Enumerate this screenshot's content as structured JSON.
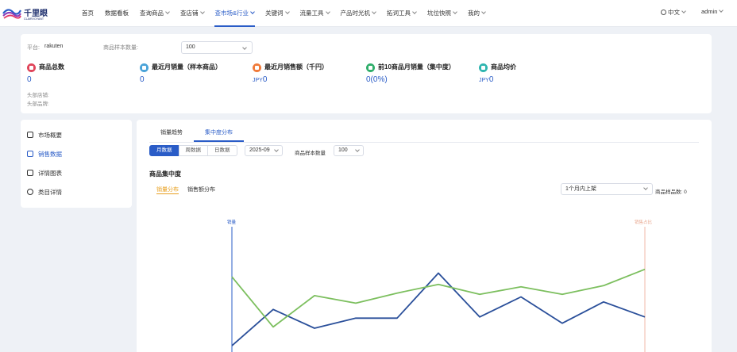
{
  "brand": {
    "name": "千里眼",
    "sub": "CLAIRVOYANT",
    "colors": {
      "primary": "#2a5cc7",
      "accent": "#e8a020"
    }
  },
  "nav": {
    "items": [
      {
        "label": "首页"
      },
      {
        "label": "数据看板"
      },
      {
        "label": "查询商品",
        "dropdown": true
      },
      {
        "label": "查店铺",
        "dropdown": true
      },
      {
        "label": "查市场&行业",
        "dropdown": true,
        "active": true
      },
      {
        "label": "关键词",
        "dropdown": true
      },
      {
        "label": "流量工具",
        "dropdown": true
      },
      {
        "label": "产品时光机",
        "dropdown": true
      },
      {
        "label": "拓词工具",
        "dropdown": true
      },
      {
        "label": "坑位快照",
        "dropdown": true
      },
      {
        "label": "我的",
        "dropdown": true
      }
    ],
    "language": "中文",
    "user": "admin"
  },
  "summary": {
    "platform_label": "平台:",
    "platform_value": "rakuten",
    "sample_label": "商品样本数量:",
    "sample_value": "100",
    "stats": [
      {
        "title": "商品总数",
        "value": "0",
        "currency": "",
        "icon": "box-icon",
        "color": "#e0455a"
      },
      {
        "title": "最近月销量（样本商品）",
        "value": "0",
        "currency": "",
        "icon": "cart-icon",
        "color": "#4aa3d8"
      },
      {
        "title": "最近月销售额（千円）",
        "value": "0",
        "currency": "JPY",
        "icon": "flame-icon",
        "color": "#f07a3a"
      },
      {
        "title": "前10商品月销量（集中度）",
        "value": "0(0%)",
        "currency": "",
        "icon": "bag-icon",
        "color": "#2fae6a"
      },
      {
        "title": "商品均价",
        "value": "0",
        "currency": "JPY",
        "icon": "price-icon",
        "color": "#2fb5b0"
      }
    ],
    "head_store_label": "头部店铺:",
    "head_brand_label": "头部品牌:"
  },
  "sidebar": {
    "items": [
      {
        "label": "市场概要",
        "icon": "overview-icon",
        "active": false
      },
      {
        "label": "销售数据",
        "icon": "sales-data-icon",
        "active": true
      },
      {
        "label": "详情图表",
        "icon": "chart-icon",
        "active": false
      },
      {
        "label": "类目详情",
        "icon": "category-icon",
        "active": false
      }
    ]
  },
  "main": {
    "tabs": [
      {
        "label": "销量趋势",
        "active": false
      },
      {
        "label": "集中度分布",
        "active": true
      }
    ],
    "period_buttons": [
      {
        "label": "月数据",
        "active": true
      },
      {
        "label": "周数据",
        "active": false
      },
      {
        "label": "日数据",
        "active": false
      }
    ],
    "month_value": "2025-09",
    "sample_label": "商品样本数量",
    "sample_value": "100",
    "section_title": "商品集中度",
    "sub_tabs": [
      {
        "label": "销量分布",
        "active": true
      },
      {
        "label": "销售额分布",
        "active": false
      }
    ],
    "listing_select": "1个月内上架",
    "count_label": "商品样品数: 0"
  },
  "chart_data": {
    "type": "line",
    "ylabel_left": "销量",
    "ylabel_right": "销售占比",
    "series": [
      {
        "values": [
          5,
          34,
          19,
          27,
          27,
          63,
          28,
          44,
          23,
          40,
          28
        ],
        "color": "#2a4f9a"
      },
      {
        "values": [
          60,
          20,
          45,
          39,
          47,
          54,
          46,
          52,
          46,
          53,
          66
        ],
        "color": "#7cbf5e"
      }
    ]
  }
}
